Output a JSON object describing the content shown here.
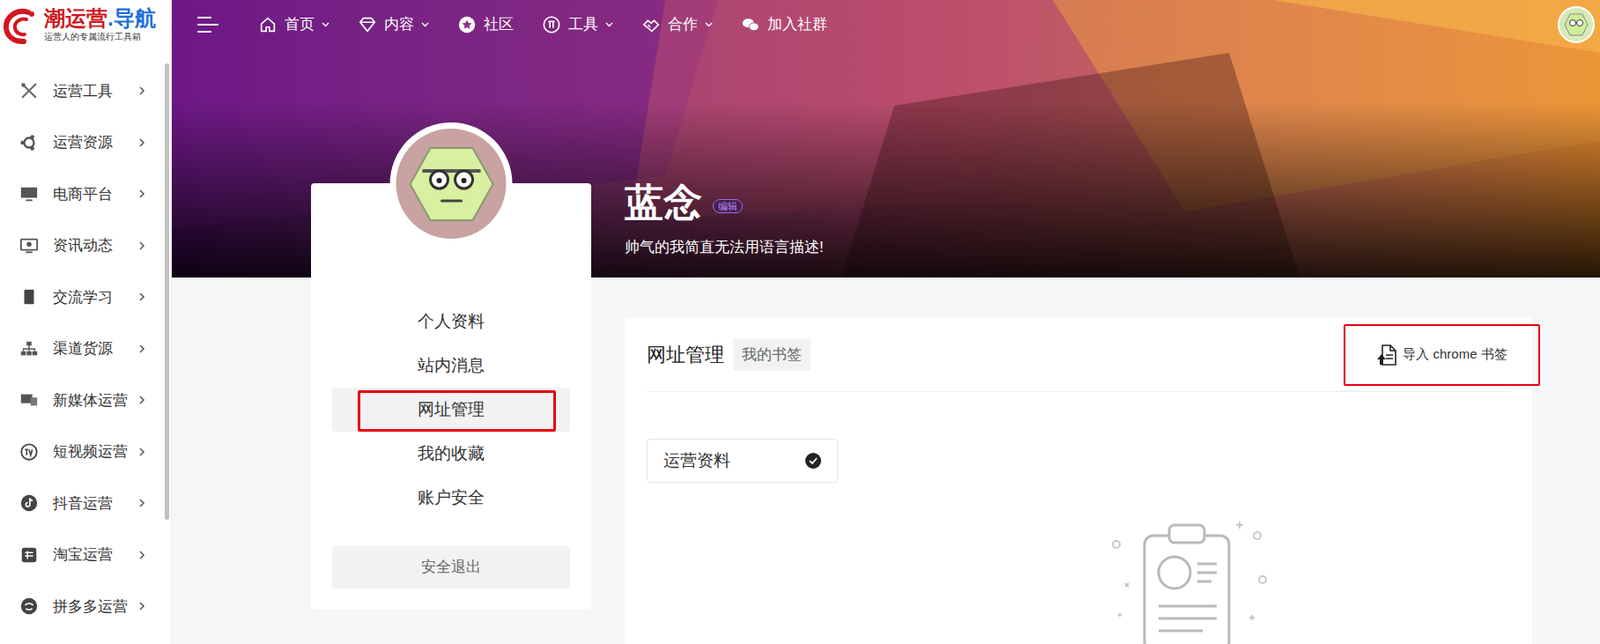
{
  "logo": {
    "brand": "潮运营",
    "dot": ".",
    "suffix": "导航",
    "tagline": "运营人的专属流行工具箱"
  },
  "sidebar": {
    "items": [
      {
        "label": "运营工具"
      },
      {
        "label": "运营资源"
      },
      {
        "label": "电商平台"
      },
      {
        "label": "资讯动态"
      },
      {
        "label": "交流学习"
      },
      {
        "label": "渠道货源"
      },
      {
        "label": "新媒体运营"
      },
      {
        "label": "短视频运营"
      },
      {
        "label": "抖音运营"
      },
      {
        "label": "淘宝运营"
      },
      {
        "label": "拼多多运营"
      }
    ]
  },
  "nav": {
    "items": [
      {
        "label": "首页",
        "dropdown": true
      },
      {
        "label": "内容",
        "dropdown": true
      },
      {
        "label": "社区",
        "dropdown": false
      },
      {
        "label": "工具",
        "dropdown": true
      },
      {
        "label": "合作",
        "dropdown": true
      },
      {
        "label": "加入社群",
        "dropdown": false
      }
    ]
  },
  "profile": {
    "name": "蓝念",
    "edit": "编辑",
    "bio": "帅气的我简直无法用语言描述!"
  },
  "menu": {
    "items": [
      {
        "label": "个人资料",
        "selected": false,
        "highlighted": false
      },
      {
        "label": "站内消息",
        "selected": false,
        "highlighted": false
      },
      {
        "label": "网址管理",
        "selected": true,
        "highlighted": true
      },
      {
        "label": "我的收藏",
        "selected": false,
        "highlighted": false
      },
      {
        "label": "账户安全",
        "selected": false,
        "highlighted": false
      }
    ],
    "logout": "安全退出"
  },
  "panel": {
    "title": "网址管理",
    "tabs": [
      {
        "label": "我的书签",
        "selected": true
      }
    ],
    "import": {
      "label": "导入 chrome 书签",
      "highlighted": true
    },
    "folders": [
      {
        "label": "运营资料",
        "checked": true
      }
    ]
  }
}
